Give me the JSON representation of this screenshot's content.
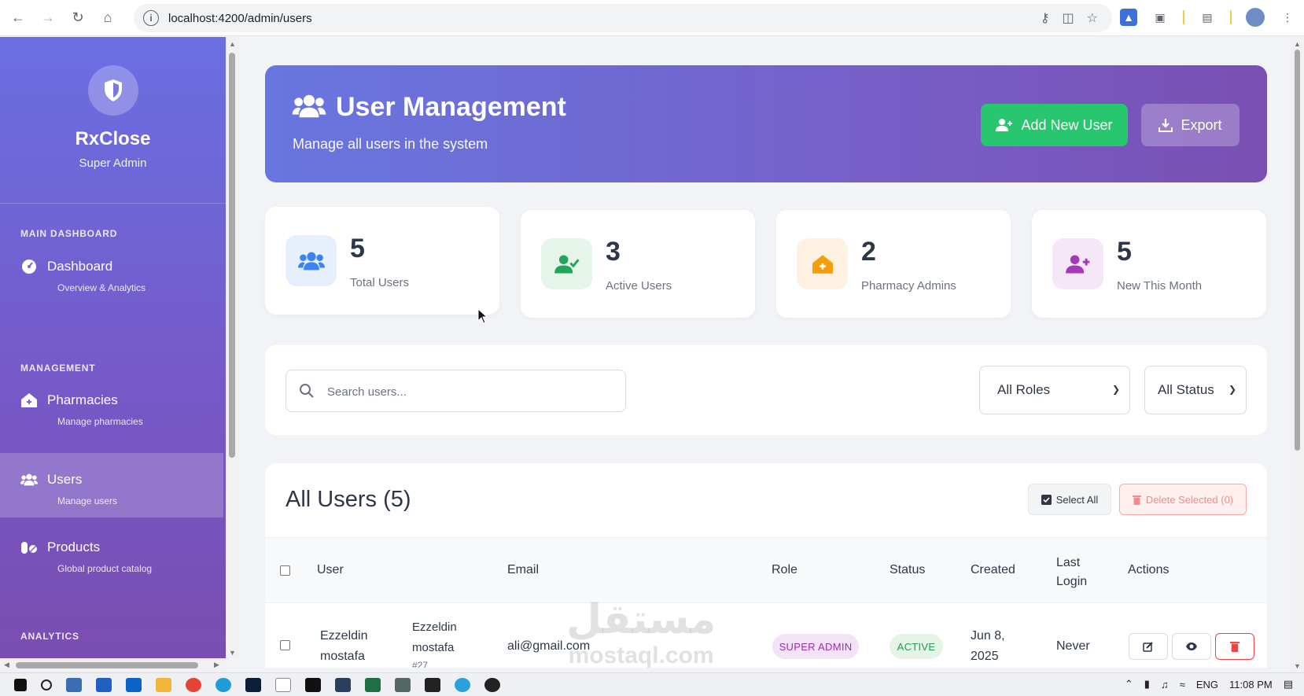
{
  "browser": {
    "url": "localhost:4200/admin/users"
  },
  "sidebar": {
    "brand_name": "RxClose",
    "brand_role": "Super Admin",
    "sections": {
      "main": "MAIN DASHBOARD",
      "management": "MANAGEMENT",
      "analytics": "ANALYTICS"
    },
    "items": [
      {
        "label": "Dashboard",
        "sub": "Overview & Analytics",
        "icon": "gauge-icon"
      },
      {
        "label": "Pharmacies",
        "sub": "Manage pharmacies",
        "icon": "clinic-icon"
      },
      {
        "label": "Users",
        "sub": "Manage users",
        "icon": "users-icon"
      },
      {
        "label": "Products",
        "sub": "Global product catalog",
        "icon": "pills-icon"
      }
    ]
  },
  "header": {
    "title": "User Management",
    "subtitle": "Manage all users in the system",
    "add_button": "Add New User",
    "export_button": "Export"
  },
  "stats": [
    {
      "value": "5",
      "label": "Total Users",
      "color": "#3b82f6",
      "bg": "#e6f0fd"
    },
    {
      "value": "3",
      "label": "Active Users",
      "color": "#22a559",
      "bg": "#e5f5ea"
    },
    {
      "value": "2",
      "label": "Pharmacy Admins",
      "color": "#f59e0b",
      "bg": "#fef1e1"
    },
    {
      "value": "5",
      "label": "New This Month",
      "color": "#a23ab8",
      "bg": "#f5e6f8"
    }
  ],
  "filters": {
    "search_placeholder": "Search users...",
    "role_select": "All Roles",
    "status_select": "All Status"
  },
  "table": {
    "title": "All Users (5)",
    "select_all": "Select All",
    "delete_selected": "Delete Selected (0)",
    "columns": [
      "User",
      "Email",
      "Role",
      "Status",
      "Created",
      "Last Login",
      "Actions"
    ],
    "rows": [
      {
        "avatar_alt": "Ezzeldin mostafa",
        "name": "Ezzeldin mostafa",
        "id": "#27",
        "email": "ali@gmail.com",
        "role": "SUPER ADMIN",
        "status": "ACTIVE",
        "created": "Jun 8, 2025",
        "last_login": "Never"
      }
    ]
  },
  "watermark": {
    "arabic": "مستقل",
    "latin": "mostaql.com"
  },
  "taskbar": {
    "lang": "ENG",
    "time": "11:08 PM"
  }
}
